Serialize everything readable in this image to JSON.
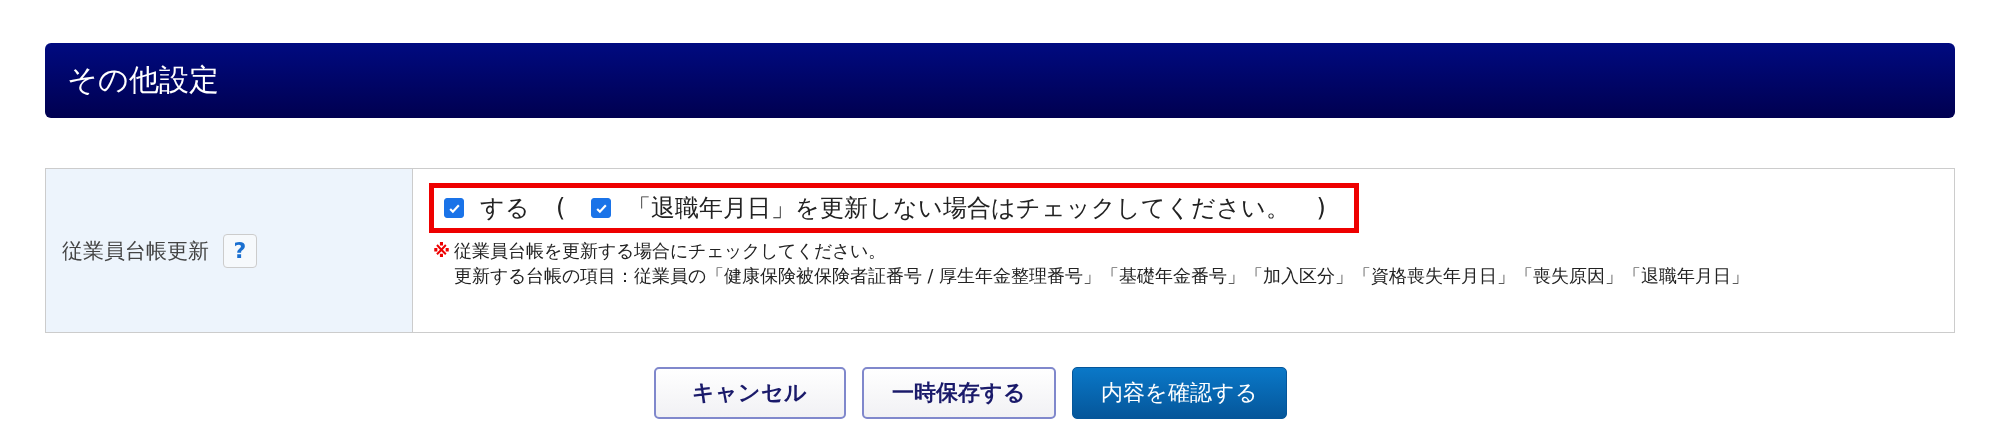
{
  "section": {
    "title": "その他設定"
  },
  "row": {
    "label": "従業員台帳更新",
    "help": "?",
    "update_checkbox": {
      "label": "する",
      "checked": true
    },
    "open_paren": "(",
    "retire_checkbox": {
      "label": "「退職年月日」を更新しない場合はチェックしてください。",
      "checked": true
    },
    "close_paren": ")",
    "note_mark": "※",
    "notes": [
      "従業員台帳を更新する場合にチェックしてください。",
      "更新する台帳の項目：従業員の「健康保険被保険者証番号 / 厚生年金整理番号」「基礎年金番号」「加入区分」「資格喪失年月日」「喪失原因」「退職年月日」"
    ]
  },
  "buttons": [
    {
      "label": "キャンセル",
      "kind": "secondary"
    },
    {
      "label": "一時保存する",
      "kind": "secondary"
    },
    {
      "label": "内容を確認する",
      "kind": "primary"
    }
  ]
}
